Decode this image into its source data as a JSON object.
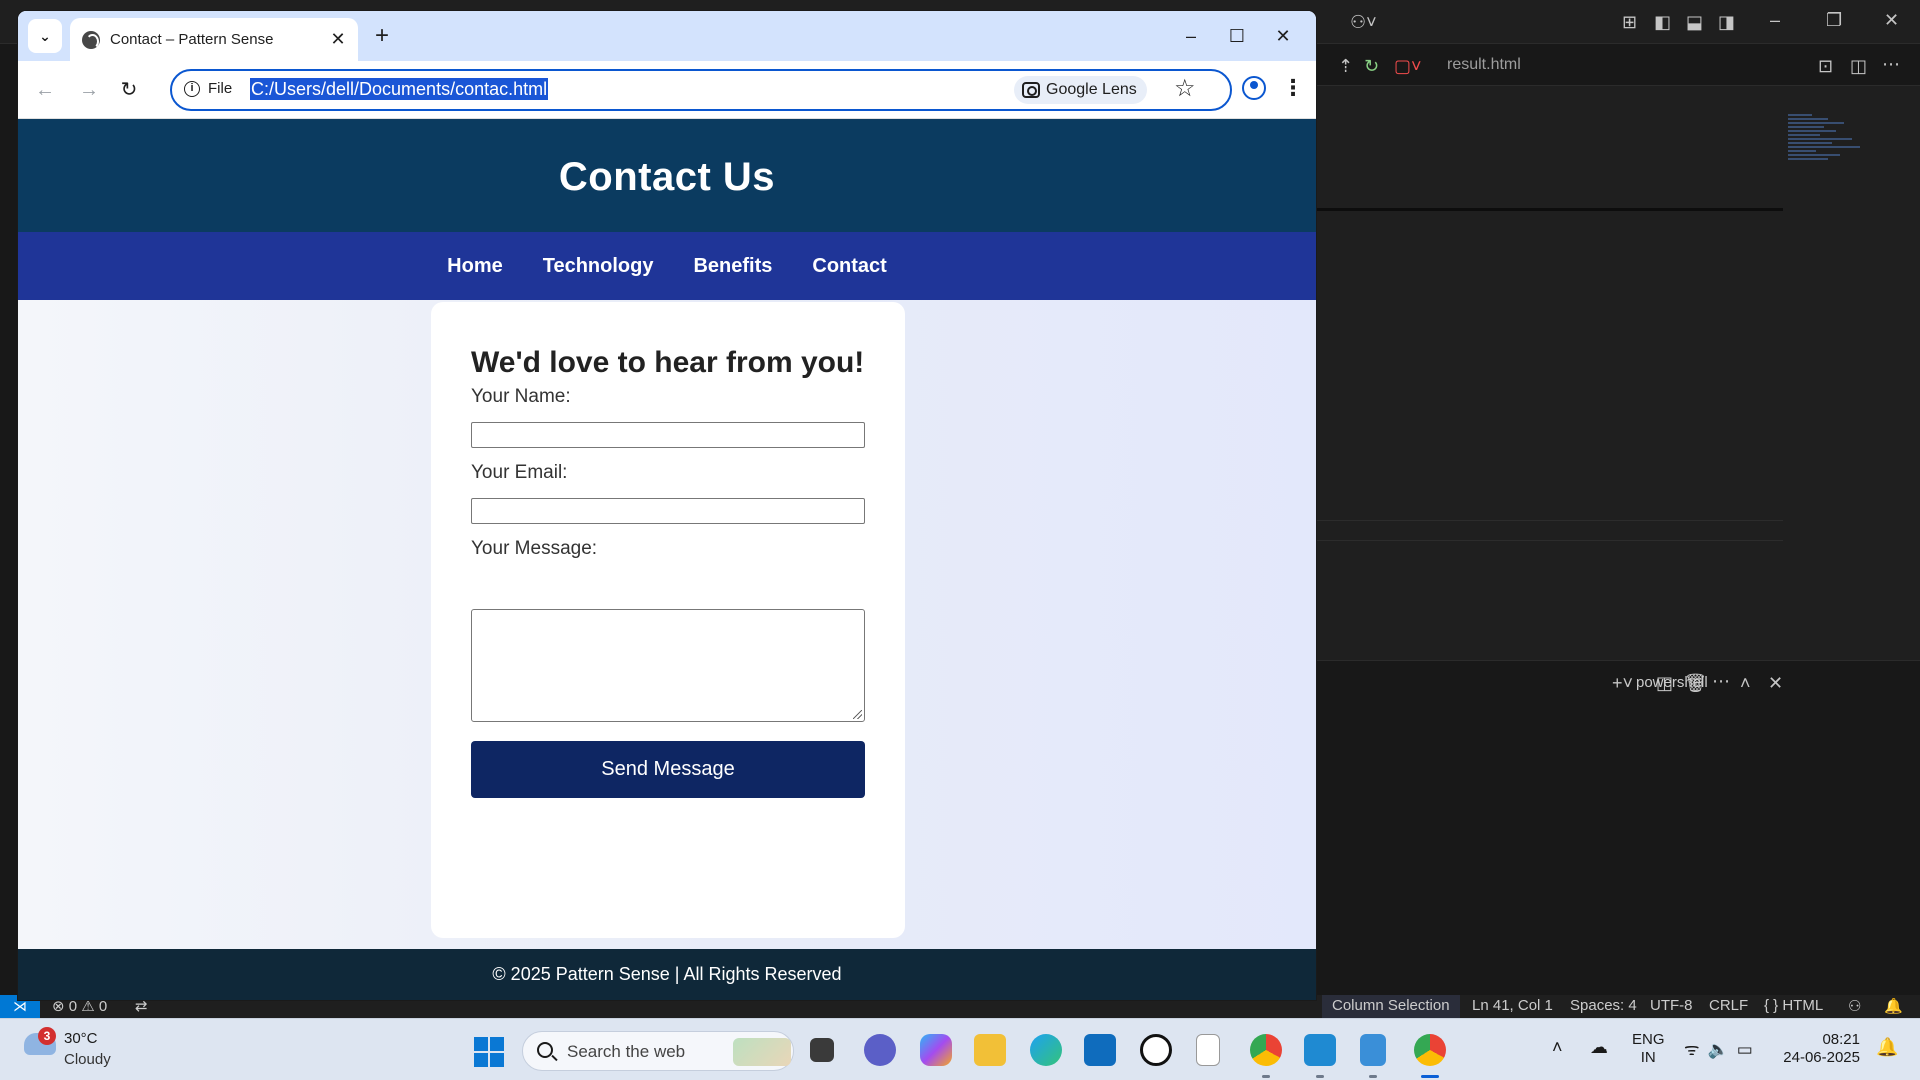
{
  "browser": {
    "tab_title": "Contact – Pattern Sense",
    "site_info_label": "File",
    "url": "C:/Users/dell/Documents/contac.html",
    "lens_label": "Google Lens"
  },
  "page": {
    "header_title": "Contact Us",
    "nav": [
      "Home",
      "Technology",
      "Benefits",
      "Contact"
    ],
    "form": {
      "heading": "We'd love to hear from you!",
      "name_label": "Your Name:",
      "name_value": "",
      "email_label": "Your Email:",
      "email_value": "",
      "message_label": "Your Message:",
      "message_value": "",
      "submit_label": "Send Message"
    },
    "footer_text": "© 2025 Pattern Sense | All Rights Reserved",
    "colors": {
      "header_bg": "#0b3b60",
      "nav_bg": "#1f3598",
      "button_bg": "#0e2663",
      "footer_bg": "#0f2839"
    }
  },
  "vscode": {
    "file_tab": "result.html",
    "terminal_label": "powershell",
    "status": {
      "problems": "⊗ 0 ⚠ 0",
      "column_selection": "Column Selection",
      "position": "Ln 41, Col 1",
      "spaces": "Spaces: 4",
      "encoding": "UTF-8",
      "line_ending": "CRLF",
      "language": "{ } HTML"
    }
  },
  "taskbar": {
    "weather_badge": "3",
    "weather_temp": "30°C",
    "weather_desc": "Cloudy",
    "search_placeholder": "Search the web",
    "lang_line1": "ENG",
    "lang_line2": "IN",
    "time": "08:21",
    "date": "24-06-2025"
  }
}
